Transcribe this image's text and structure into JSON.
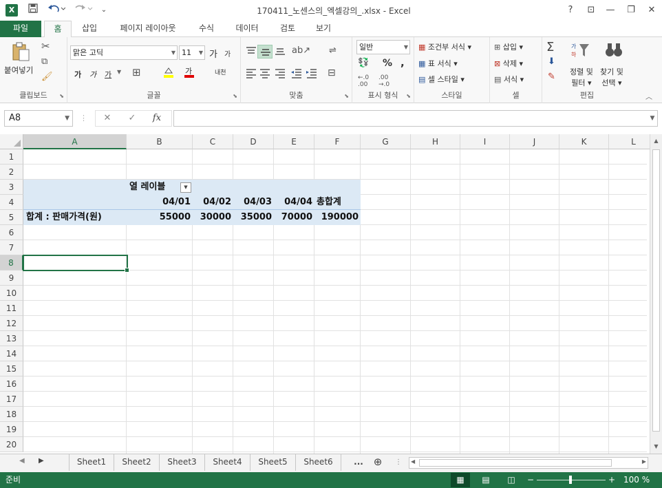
{
  "window": {
    "title": "170411_노센스의_엑셀강의_.xlsx - Excel",
    "app_icon": "X",
    "help": "?",
    "controls": {
      "ribbon_options": "⊡",
      "minimize": "—",
      "restore": "❐",
      "close": "✕"
    }
  },
  "quick_access": {
    "save_icon": "💾",
    "undo_icon": "↶",
    "redo_icon": "↷",
    "customize_icon": "⌄"
  },
  "ribbon": {
    "tabs": [
      "파일",
      "홈",
      "삽입",
      "페이지 레이아웃",
      "수식",
      "데이터",
      "검토",
      "보기"
    ],
    "active_tab": "홈",
    "groups": {
      "clipboard": {
        "label": "클립보드",
        "paste": "붙여넣기"
      },
      "font": {
        "label": "글꼴",
        "font_name": "맑은 고딕",
        "font_size": "11",
        "bold": "가",
        "italic": "가",
        "underline": "가",
        "grow": "가",
        "shrink": "가",
        "phonetic": "내천"
      },
      "alignment": {
        "label": "맞춤"
      },
      "number": {
        "label": "표시 형식",
        "format": "일반",
        "percent": "%",
        "comma": ","
      },
      "styles": {
        "label": "스타일",
        "conditional": "조건부 서식",
        "table": "표 서식",
        "cell_styles": "셀 스타일"
      },
      "cells": {
        "label": "셀",
        "insert": "삽입",
        "delete": "삭제",
        "format": "서식"
      },
      "editing": {
        "label": "편집",
        "sort": "정렬 및",
        "sort2": "필터",
        "find": "찾기 및",
        "find2": "선택"
      }
    }
  },
  "formula_bar": {
    "name_box": "A8",
    "cancel": "✕",
    "enter": "✓",
    "fx": "fx",
    "value": ""
  },
  "grid": {
    "columns": [
      "A",
      "B",
      "C",
      "D",
      "E",
      "F",
      "G",
      "H",
      "I",
      "J",
      "K",
      "L"
    ],
    "rows": [
      "1",
      "2",
      "3",
      "4",
      "5",
      "6",
      "7",
      "8",
      "9",
      "10",
      "11",
      "12",
      "13",
      "14",
      "15",
      "16",
      "17",
      "18",
      "19",
      "20"
    ],
    "selected_cell": "A8",
    "pivot": {
      "column_labels_header": "열 레이블",
      "dates": [
        "04/01",
        "04/02",
        "04/03",
        "04/04"
      ],
      "grand_total_header": "총합계",
      "row_label": "합계 : 판매가격(원)",
      "values": [
        "55000",
        "30000",
        "35000",
        "70000",
        "190000"
      ]
    }
  },
  "sheets": {
    "tabs": [
      "Sheet1",
      "Sheet2",
      "Sheet3",
      "Sheet4",
      "Sheet5",
      "Sheet6"
    ],
    "more": "...",
    "add": "⊕"
  },
  "status": {
    "mode": "준비",
    "zoom": "100 %",
    "zoom_minus": "−",
    "zoom_plus": "+"
  },
  "colors": {
    "accent": "#217346",
    "pivot_fill": "#dce9f5"
  }
}
